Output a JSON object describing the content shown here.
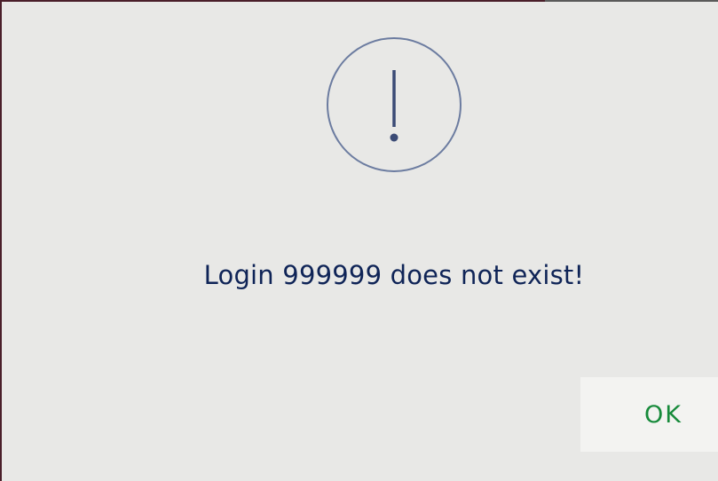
{
  "dialog": {
    "icon": "exclamation-circle-icon",
    "message": "Login 999999 does not exist!",
    "ok_label": "OK"
  },
  "colors": {
    "background": "#e8e8e6",
    "message_text": "#0f2457",
    "icon_stroke": "#6c7ca0",
    "icon_mark": "#3a4a75",
    "ok_text": "#168a3a",
    "ok_background": "#f3f3f1"
  }
}
